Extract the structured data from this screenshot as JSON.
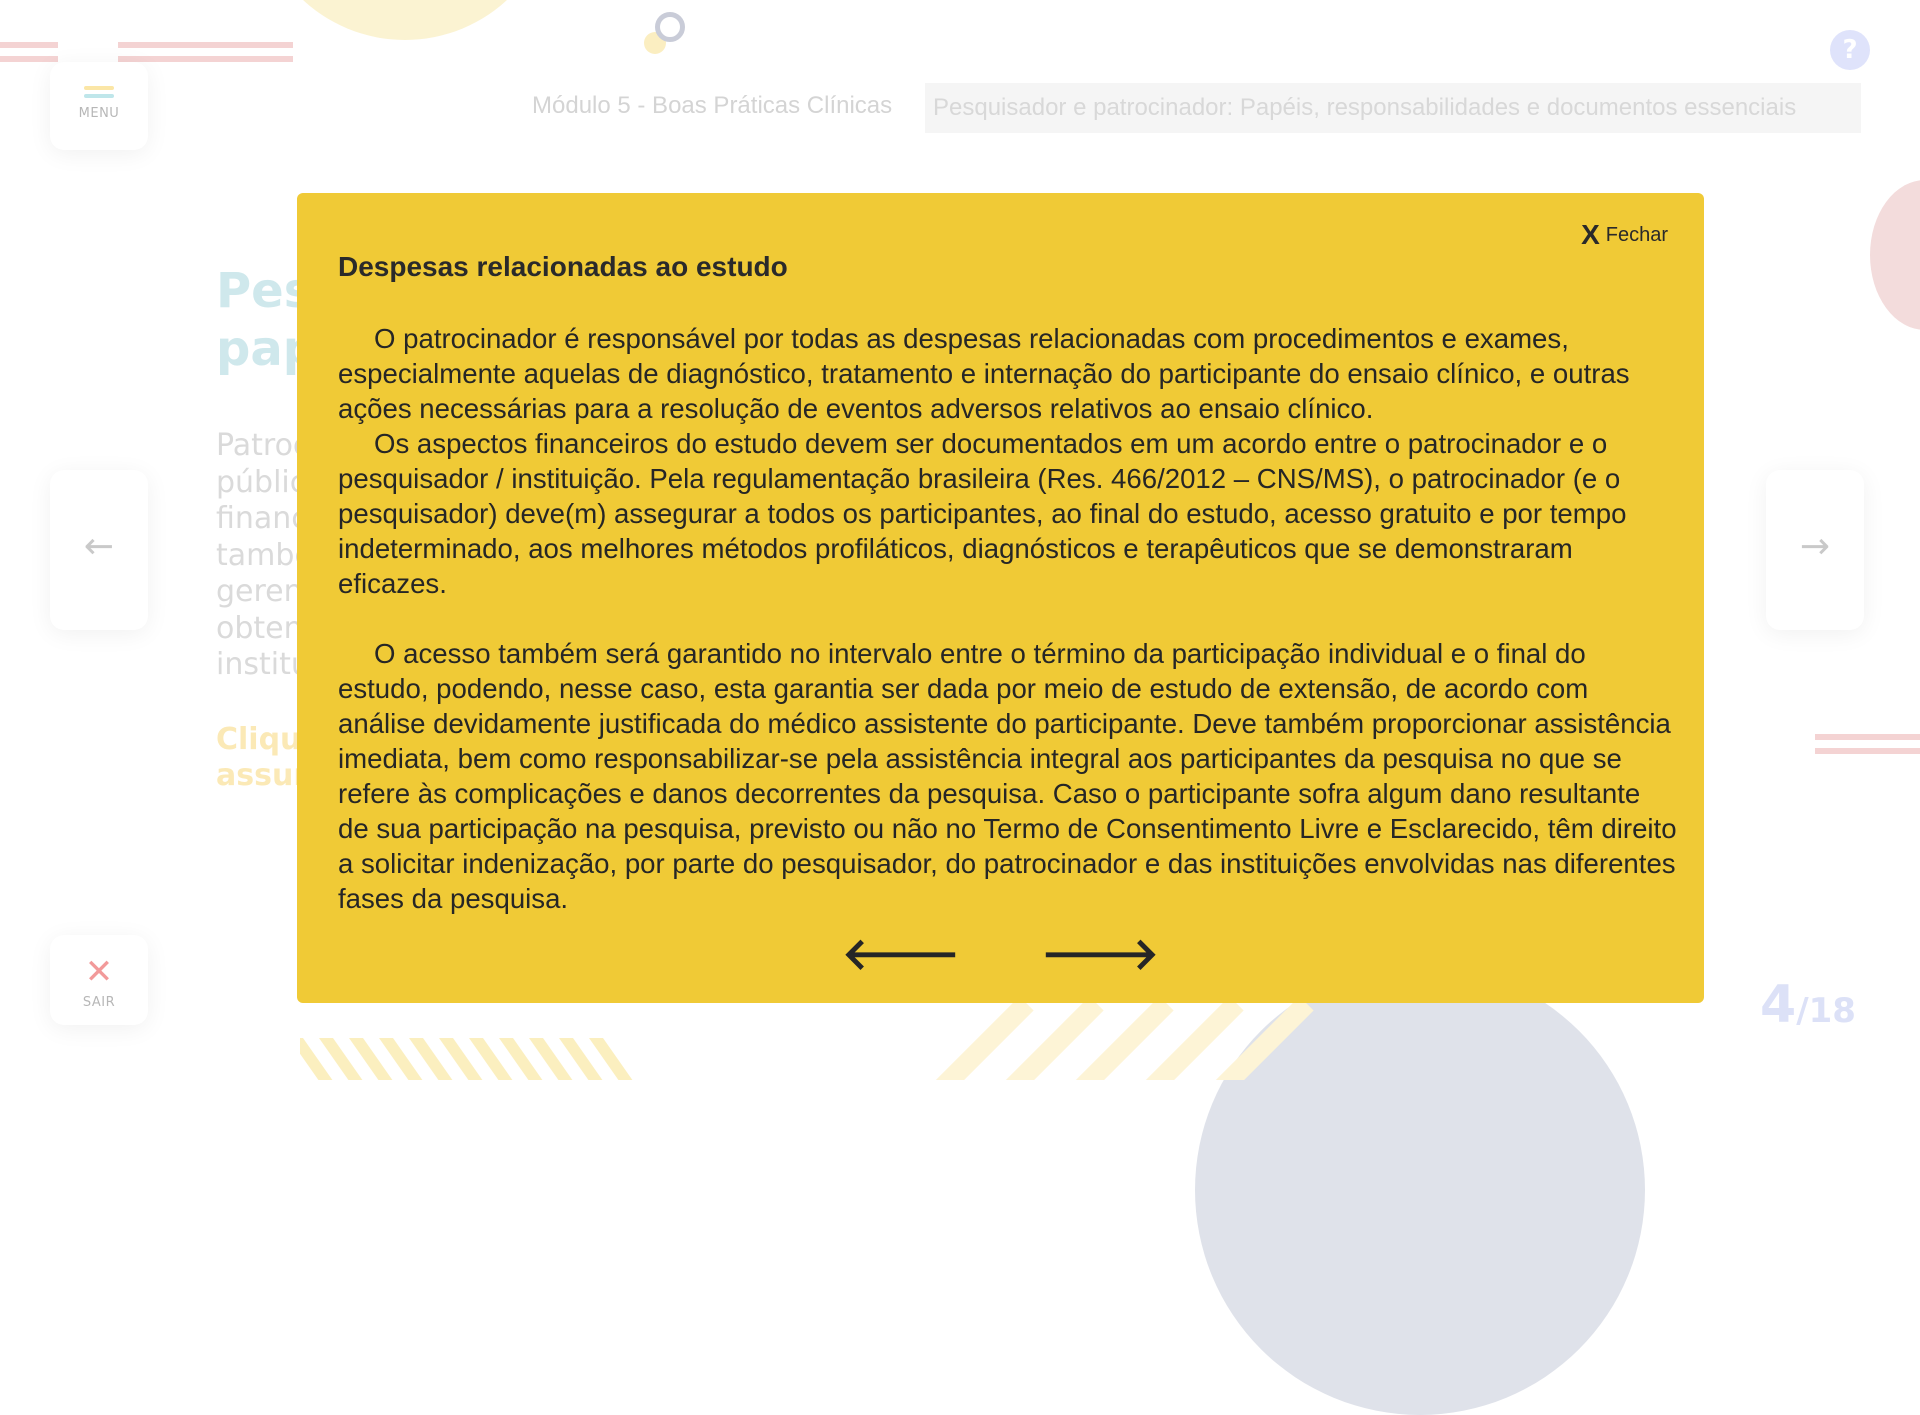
{
  "menu": {
    "label": "MENU"
  },
  "exit": {
    "label": "SAIR"
  },
  "help": {
    "label": "?"
  },
  "breadcrumb": {
    "module": "Módulo 5 - Boas Práticas Clínicas",
    "topic": "Pesquisador e patrocinador: Papéis, responsabilidades e documentos essenciais"
  },
  "background": {
    "title_lines": [
      "Pes",
      "pap"
    ],
    "body_lines": [
      "Patroc",
      "públic",
      "financ",
      "tambe",
      "geren",
      "obten",
      "institu"
    ],
    "link_lines": [
      "Clique",
      "assun"
    ]
  },
  "nav": {
    "prev_icon": "←",
    "next_icon": "→"
  },
  "pager": {
    "current": "4",
    "total": "/18"
  },
  "modal": {
    "close_icon": "X",
    "close_label": "Fechar",
    "title": "Despesas relacionadas ao estudo",
    "paragraphs": [
      "O patrocinador é responsável por todas as despesas relacionadas com procedimentos e exames, especialmente aquelas de diagnóstico, tratamento e internação do participante do ensaio clínico, e outras ações necessárias para a resolução de eventos adversos relativos ao ensaio clínico.",
      "Os aspectos financeiros do estudo devem ser documentados em um acordo entre o patrocinador e o pesquisador / instituição. Pela regulamentação brasileira (Res. 466/2012 – CNS/MS), o patrocinador (e o pesquisador) deve(m) assegurar a todos os participantes, ao final do estudo, acesso gratuito e por tempo indeterminado, aos melhores métodos profiláticos, diagnósticos e terapêuticos que se demonstraram eficazes.",
      "O acesso também será garantido no intervalo entre o término da participação individual e o final do estudo, podendo, nesse caso, esta garantia ser dada por meio de estudo de extensão, de acordo com análise devidamente justificada do médico assistente do participante. Deve também proporcionar assistência imediata, bem como responsabilizar-se pela assistência integral aos participantes da pesquisa no que se refere às complicações e danos decorrentes da pesquisa. Caso o participante sofra algum dano resultante de sua participação na pesquisa, previsto ou não no Termo de Consentimento Livre e Esclarecido, têm direito a solicitar indenização, por parte do pesquisador, do patrocinador e das instituições envolvidas nas diferentes fases da pesquisa."
    ],
    "prev_icon": "🡐",
    "next_icon": "🡒"
  }
}
